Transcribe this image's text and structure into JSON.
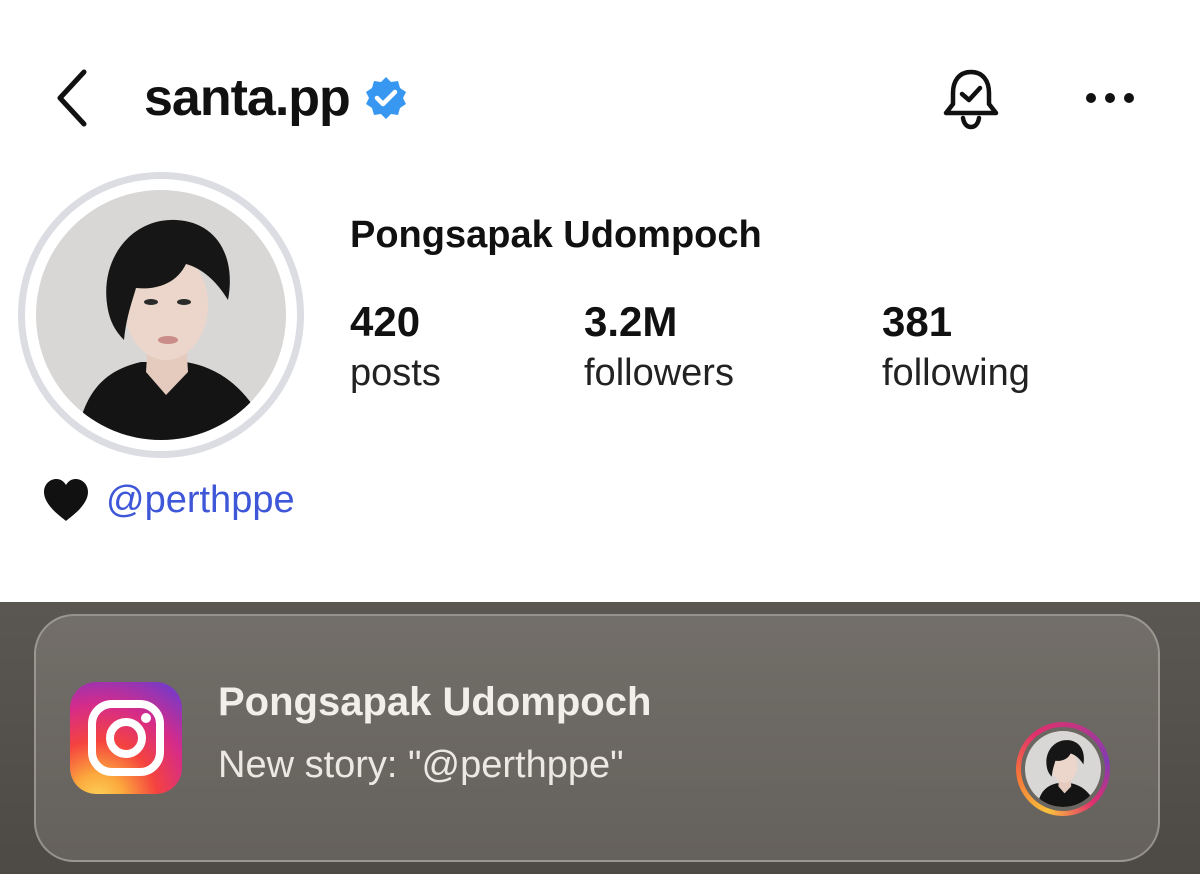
{
  "header": {
    "username": "santa.pp",
    "verified": true,
    "back_icon": "chevron-left-icon",
    "bell_icon": "bell-check-icon",
    "more_icon": "more-horizontal-icon"
  },
  "profile": {
    "full_name": "Pongsapak Udompoch",
    "stats": [
      {
        "value": "420",
        "label": "posts"
      },
      {
        "value": "3.2M",
        "label": "followers"
      },
      {
        "value": "381",
        "label": "following"
      }
    ],
    "bio": {
      "emoji": "🖤",
      "mention": "@perthppe"
    }
  },
  "notification": {
    "app_icon": "instagram-icon",
    "title": "Pongsapak Udompoch",
    "body": "New story: \"@perthppe\""
  },
  "colors": {
    "text": "#111111",
    "verified_blue": "#3897f0",
    "mention_blue": "#3e57d8",
    "avatar_ring": "#dbdde3",
    "overlay": "#55524e"
  }
}
